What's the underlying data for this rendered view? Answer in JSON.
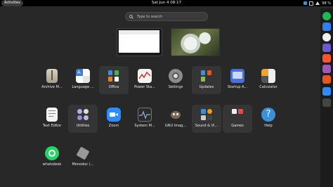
{
  "topbar": {
    "activities": "Activities",
    "clock": "Sat Jun 4  08:17",
    "battery": "98 %"
  },
  "search": {
    "placeholder": "Type to search"
  },
  "apps": [
    {
      "label": "Archive M..."
    },
    {
      "label": "Language ..."
    },
    {
      "label": "Office"
    },
    {
      "label": "Power Sta..."
    },
    {
      "label": "Settings"
    },
    {
      "label": "Updates"
    },
    {
      "label": "Startup A..."
    },
    {
      "label": "Calculator"
    },
    {
      "label": "Text Editor"
    },
    {
      "label": "Utilities"
    },
    {
      "label": "Zoom"
    },
    {
      "label": "System M..."
    },
    {
      "label": "GNU Imag..."
    },
    {
      "label": "Sound & Vi..."
    },
    {
      "label": "Games"
    },
    {
      "label": "Help"
    },
    {
      "label": "whatsdesk"
    },
    {
      "label": "Monodoc (..."
    }
  ],
  "colors": {
    "background": "#282828",
    "topbar": "#000000",
    "accent": "#3d8fd8"
  }
}
